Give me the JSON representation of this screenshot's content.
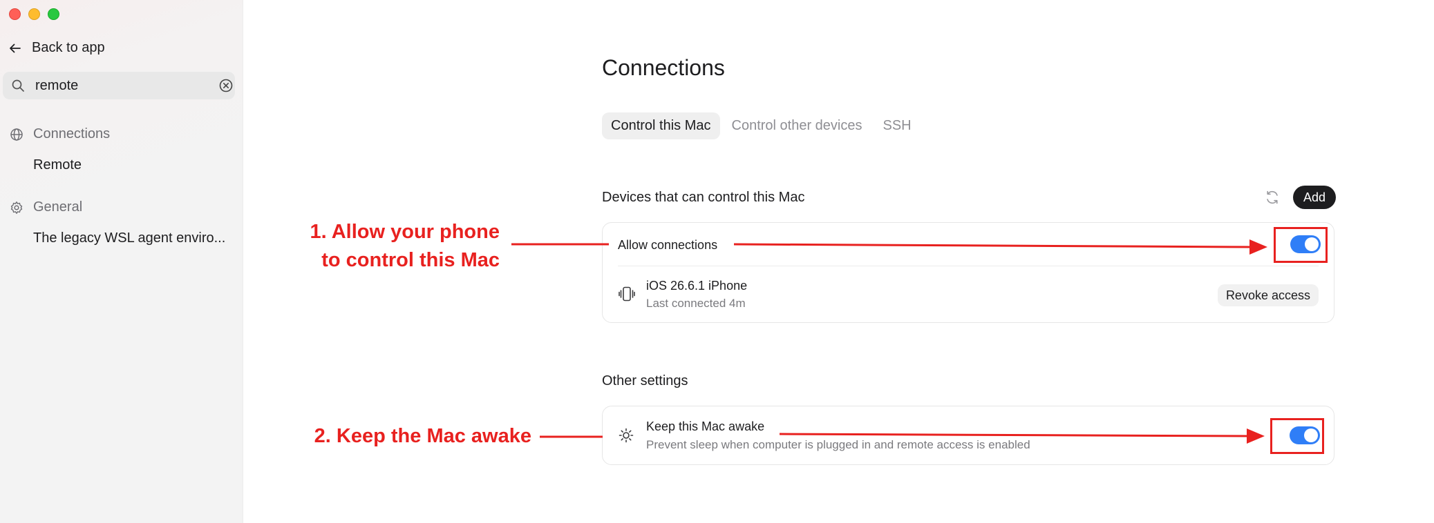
{
  "window": {
    "traffic_lights": [
      "close",
      "minimize",
      "maximize"
    ]
  },
  "sidebar": {
    "back_label": "Back to app",
    "search": {
      "value": "remote",
      "placeholder": ""
    },
    "groups": [
      {
        "label": "Connections",
        "icon": "globe-icon",
        "items": [
          "Remote"
        ]
      },
      {
        "label": "General",
        "icon": "gear-icon",
        "items": [
          "The legacy WSL agent enviro..."
        ]
      }
    ]
  },
  "main": {
    "title": "Connections",
    "tabs": [
      {
        "label": "Control this Mac",
        "active": true
      },
      {
        "label": "Control other devices",
        "active": false
      },
      {
        "label": "SSH",
        "active": false
      }
    ],
    "devices_section": {
      "title": "Devices that can control this Mac",
      "add_label": "Add",
      "allow_label": "Allow connections",
      "allow_enabled": true,
      "device": {
        "name": "iOS 26.6.1 iPhone",
        "last_connected": "Last connected 4m",
        "revoke_label": "Revoke access"
      }
    },
    "other_section": {
      "title": "Other settings",
      "awake_label": "Keep this Mac awake",
      "awake_desc": "Prevent sleep when computer is plugged in and remote access is enabled",
      "awake_enabled": true
    }
  },
  "annotations": {
    "step1_line1": "1. Allow your phone",
    "step1_line2": "to control this Mac",
    "step2": "2. Keep the Mac awake",
    "color": "#e8211f"
  },
  "colors": {
    "toggle_on": "#2f7ef7",
    "add_button": "#1d1d1f"
  }
}
